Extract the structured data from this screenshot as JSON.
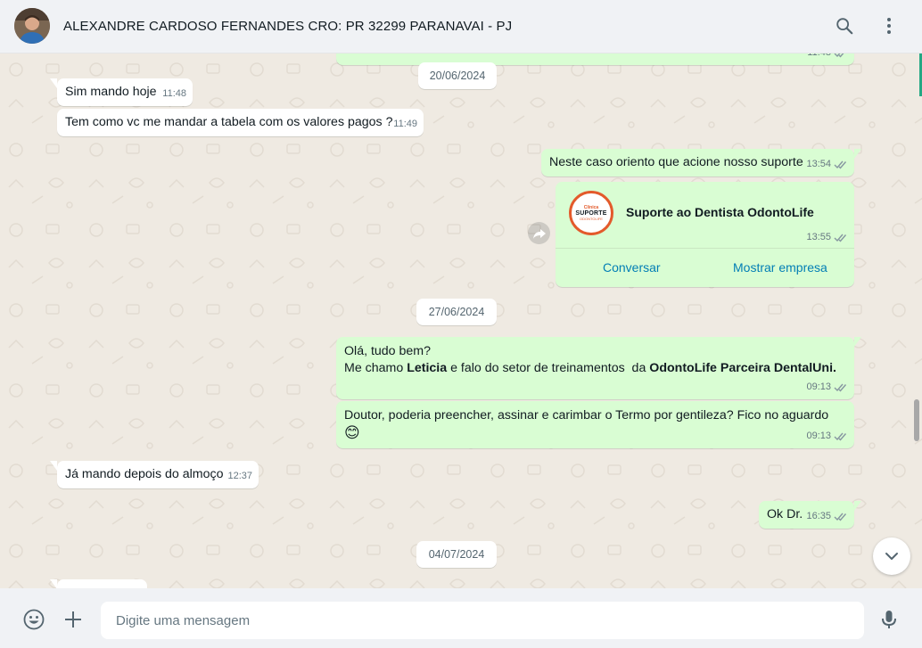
{
  "header": {
    "contact_name": "ALEXANDRE CARDOSO FERNANDES CRO: PR 32299 PARANAVAI - PJ"
  },
  "messages": {
    "m0": {
      "time": "11:48"
    },
    "d1": "20/06/2024",
    "m1": {
      "text": "Sim mando hoje",
      "time": "11:48"
    },
    "m2": {
      "text": "Tem como vc me mandar a tabela com os valores pagos ?",
      "time": "11:49"
    },
    "m3": {
      "text": "Neste caso oriento que acione nosso suporte",
      "time": "13:54"
    },
    "card": {
      "logo_top": "Clinica",
      "logo_mid": "SUPORTE",
      "logo_sub": "ODONTOLIFE",
      "name": "Suporte ao Dentista OdontoLife",
      "time": "13:55",
      "chat_btn": "Conversar",
      "profile_btn": "Mostrar empresa"
    },
    "d2": "27/06/2024",
    "m4": {
      "line1": "Olá, tudo bem?",
      "pre": "Me chamo ",
      "name": "Leticia",
      "mid": " e falo do setor de treinamentos  da ",
      "company": "OdontoLife Parceira DentalUni.",
      "time": "09:13"
    },
    "m5": {
      "text": "Doutor, poderia preencher, assinar e carimbar o Termo por gentileza? Fico no aguardo ",
      "emoji": "😊",
      "time": "09:13"
    },
    "m6": {
      "text": "Já mando depois do almoço",
      "time": "12:37"
    },
    "m7": {
      "text": "Ok Dr.",
      "time": "16:35"
    },
    "d3": "04/07/2024"
  },
  "composer": {
    "placeholder": "Digite uma mensagem"
  },
  "colors": {
    "incoming": "#ffffff",
    "outgoing": "#d9fdd3",
    "link": "#027eb5",
    "background": "#efeae2"
  }
}
